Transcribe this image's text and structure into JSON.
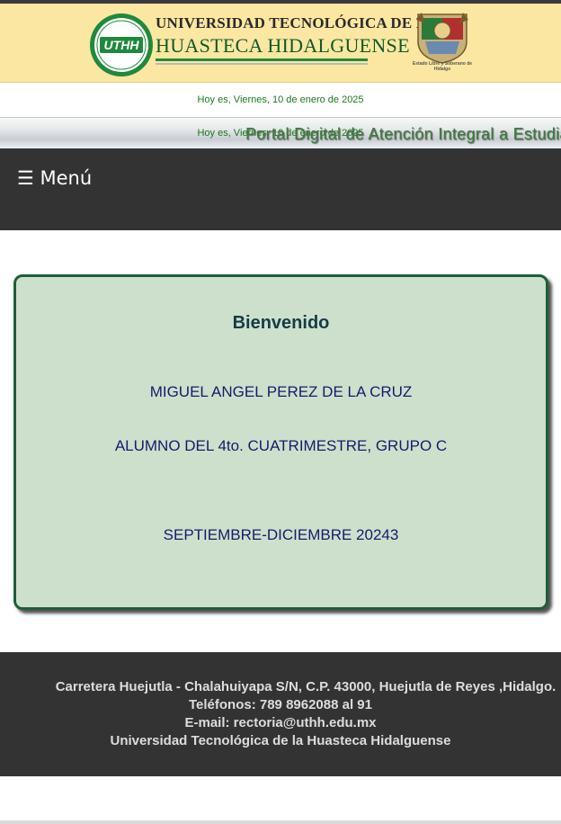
{
  "header": {
    "uni_line1": "UNIVERSIDAD TECNOLÓGICA DE LA",
    "uni_line2": "HUASTECA HIDALGUENSE",
    "logo_initials": "UTHH",
    "crest_caption": "Estado Libre y Soberano de Hidalgo",
    "colors": {
      "header_bg": "#fbe7a1",
      "brand_green": "#1f8a3c"
    }
  },
  "date_bar": {
    "text": "Hoy es, Viernes, 10 de enero de 2025"
  },
  "portal_bar": {
    "date_text": "Hoy es, Viernes, 10 de enero de 2025",
    "title": "Portal Digital de Atención Integral a Estudiantes"
  },
  "navbar": {
    "menu_label": "☰ Menú",
    "icon": "hamburger-icon"
  },
  "welcome": {
    "title": "Bienvenido",
    "student_name": "MIGUEL ANGEL PEREZ DE LA CRUZ",
    "student_level": "ALUMNO DEL 4to. CUATRIMESTRE, GRUPO C",
    "period": "SEPTIEMBRE-DICIEMBRE 20243",
    "colors": {
      "card_bg": "#cde0cc",
      "card_border": "#1e5f36"
    }
  },
  "footer": {
    "address": "Carretera Huejutla - Chalahuiyapa S/N, C.P. 43000, Huejutla de Reyes ,Hidalgo.",
    "phones": "Teléfonos: 789 8962088 al 91",
    "email": "E-mail: rectoria@uthh.edu.mx",
    "institution": "Universidad Tecnológica de la Huasteca Hidalguense"
  }
}
